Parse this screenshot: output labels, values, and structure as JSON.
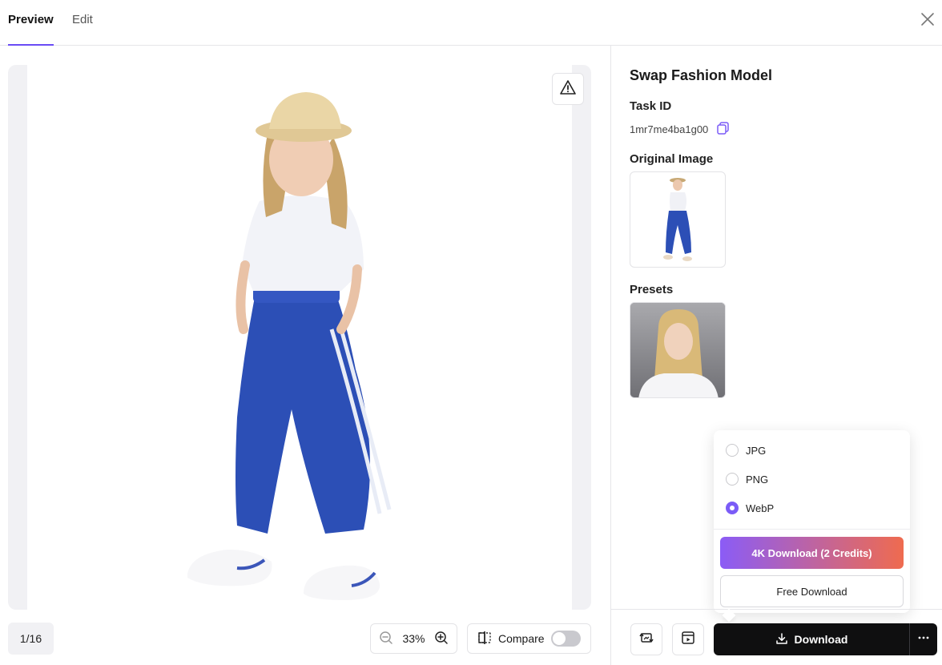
{
  "tabs": {
    "preview": "Preview",
    "edit": "Edit"
  },
  "preview": {
    "page_indicator": "1/16",
    "zoom": "33%",
    "compare_label": "Compare"
  },
  "panel": {
    "title": "Swap Fashion Model",
    "task_id_label": "Task ID",
    "task_id_value": "1mr7me4ba1g00",
    "original_image_label": "Original Image",
    "presets_label": "Presets"
  },
  "download_menu": {
    "formats": [
      {
        "label": "JPG",
        "selected": false
      },
      {
        "label": "PNG",
        "selected": false
      },
      {
        "label": "WebP",
        "selected": true
      }
    ],
    "hd_button": "4K Download (2 Credits)",
    "free_button": "Free Download"
  },
  "actions": {
    "download_label": "Download"
  },
  "colors": {
    "accent": "#7b5cf7",
    "gradient_start": "#8b5cf6",
    "gradient_end": "#ef6b4f",
    "dark": "#0f0f10"
  }
}
